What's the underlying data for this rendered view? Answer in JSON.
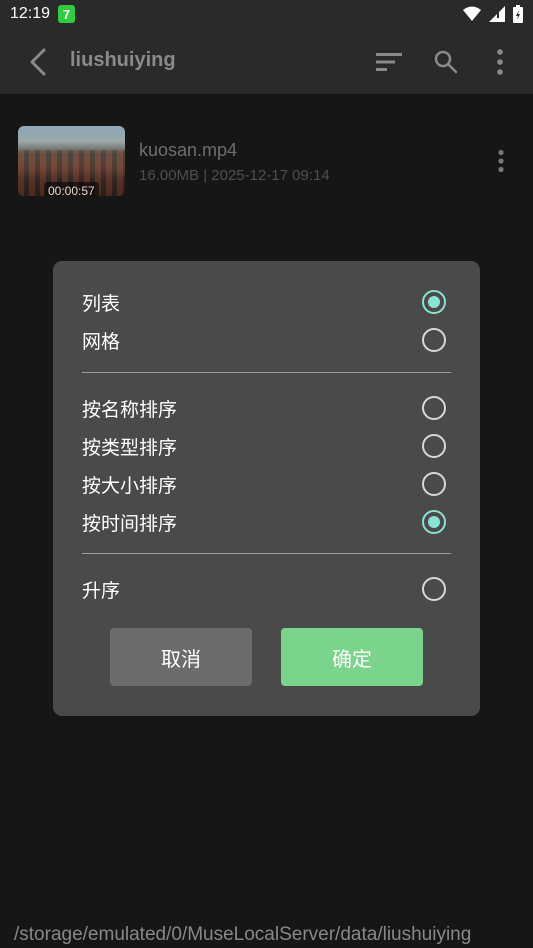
{
  "status_bar": {
    "time": "12:19",
    "notification_badge": "7"
  },
  "app_bar": {
    "title": "liushuiying",
    "icons": [
      "back-arrow-icon",
      "sort-icon",
      "search-icon",
      "more-vert-icon"
    ]
  },
  "files": [
    {
      "name": "kuosan.mp4",
      "meta": "16.00MB | 2025-12-17 09:14",
      "duration": "00:00:57"
    }
  ],
  "dialog": {
    "view_options": [
      {
        "label": "列表",
        "checked": true
      },
      {
        "label": "网格",
        "checked": false
      }
    ],
    "sort_options": [
      {
        "label": "按名称排序",
        "checked": false
      },
      {
        "label": "按类型排序",
        "checked": false
      },
      {
        "label": "按大小排序",
        "checked": false
      },
      {
        "label": "按时间排序",
        "checked": true
      }
    ],
    "order_options": [
      {
        "label": "升序",
        "checked": false
      }
    ],
    "cancel_label": "取消",
    "confirm_label": "确定",
    "colors": {
      "accent": "#8ae3d2",
      "confirm": "#7bd48b",
      "cancel": "#6c6c6c"
    }
  },
  "footer": {
    "path": "/storage/emulated/0/MuseLocalServer/data/liushuiying"
  }
}
